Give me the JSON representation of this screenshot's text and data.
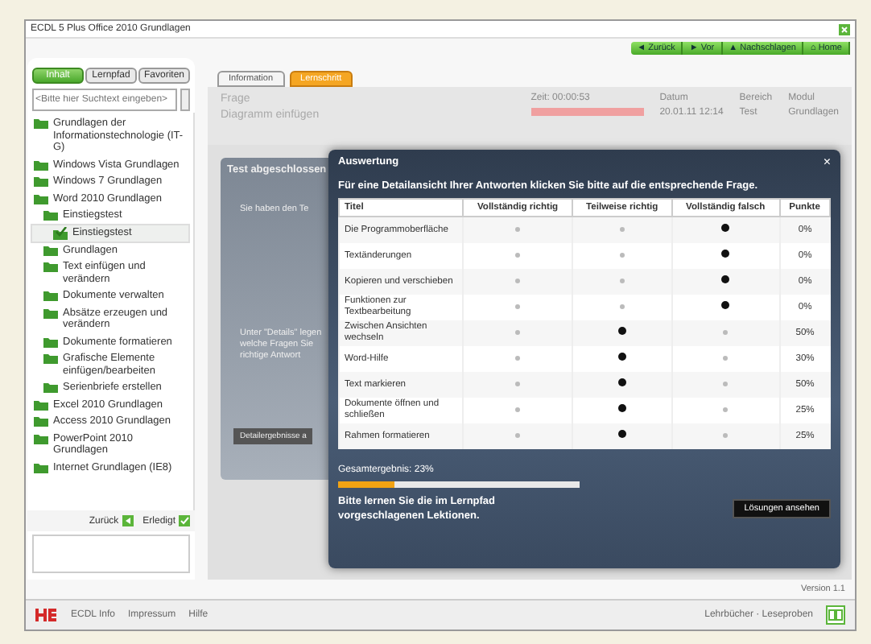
{
  "window": {
    "title": "ECDL 5 Plus Office 2010 Grundlagen"
  },
  "nav_buttons": [
    {
      "label": "◄ Zurück"
    },
    {
      "label": "► Vor"
    },
    {
      "label": "▲ Nachschlagen"
    },
    {
      "label": "⌂ Home"
    }
  ],
  "sidebar": {
    "tabs": [
      {
        "label": "Inhalt",
        "selected": true
      },
      {
        "label": "Lernpfad",
        "selected": false
      },
      {
        "label": "Favoriten",
        "selected": false
      }
    ],
    "search": {
      "placeholder": "<Bitte hier Suchtext eingeben>"
    },
    "tree": [
      {
        "label": "Grundlagen der Informationstechnologie (IT-G)",
        "selected": false
      },
      {
        "label": "Windows Vista Grundlagen",
        "selected": false
      },
      {
        "label": "Windows 7 Grundlagen",
        "selected": false
      },
      {
        "label": "Word 2010 Grundlagen",
        "selected": false,
        "children": [
          {
            "label": "Einstiegstest",
            "selected": false,
            "children": [
              {
                "label": "Einstiegstest",
                "selected": true,
                "kind": "done"
              }
            ]
          },
          {
            "label": "Grundlagen",
            "selected": false
          },
          {
            "label": "Text einfügen und verändern",
            "selected": false
          },
          {
            "label": "Dokumente verwalten",
            "selected": false
          },
          {
            "label": "Absätze erzeugen und verändern",
            "selected": false
          },
          {
            "label": "Dokumente formatieren",
            "selected": false
          },
          {
            "label": "Grafische Elemente einfügen/bearbeiten",
            "selected": false
          },
          {
            "label": "Serienbriefe erstellen",
            "selected": false
          }
        ]
      },
      {
        "label": "Excel 2010 Grundlagen",
        "selected": false
      },
      {
        "label": "Access 2010 Grundlagen",
        "selected": false
      },
      {
        "label": "PowerPoint 2010 Grundlagen",
        "selected": false
      },
      {
        "label": "Internet Grundlagen (IE8)",
        "selected": false
      }
    ],
    "bottom_buttons": [
      {
        "label": "Zurück",
        "kind": "back"
      },
      {
        "label": "Erledigt",
        "kind": "done"
      }
    ]
  },
  "main": {
    "tabs": [
      {
        "label": "Information",
        "selected": false
      },
      {
        "label": "Lernschritt",
        "selected": true
      }
    ],
    "header": [
      {
        "label": "Frage",
        "value": "Diagramm einfügen"
      },
      {
        "label": "Zeit: 00:00:53",
        "kind": "timer",
        "level": 1
      },
      {
        "label": "Datum",
        "value": "20.01.11 12:14"
      },
      {
        "label": "Bereich",
        "value": "Test"
      },
      {
        "label": "Modul",
        "value": "Grundlagen"
      }
    ],
    "test_panel": {
      "title": "Test abgeschlossen",
      "lines": [
        "Sie haben den Te",
        "Unter \"Details\" legen",
        "welche Fragen Sie",
        "richtige Antwort"
      ],
      "button": "Detailergebnisse a"
    }
  },
  "dialog": {
    "title": "Auswertung",
    "close": "×",
    "intro": "Für eine Detailansicht Ihrer Antworten klicken Sie bitte auf die entsprechende Frage.",
    "columns": [
      "Titel",
      "Vollständig richtig",
      "Teilweise richtig",
      "Vollständig falsch",
      "Punkte"
    ],
    "rows": [
      {
        "title": "Die Programmoberfläche",
        "choices": [
          {
            "selected": false
          },
          {
            "selected": false
          },
          {
            "selected": true
          }
        ],
        "points": "0%"
      },
      {
        "title": "Textänderungen",
        "choices": [
          {
            "selected": false
          },
          {
            "selected": false
          },
          {
            "selected": true
          }
        ],
        "points": "0%"
      },
      {
        "title": "Kopieren und verschieben",
        "choices": [
          {
            "selected": false
          },
          {
            "selected": false
          },
          {
            "selected": true
          }
        ],
        "points": "0%"
      },
      {
        "title": "Funktionen zur Textbearbeitung",
        "choices": [
          {
            "selected": false
          },
          {
            "selected": false
          },
          {
            "selected": true
          }
        ],
        "points": "0%"
      },
      {
        "title": "Zwischen Ansichten wechseln",
        "choices": [
          {
            "selected": false
          },
          {
            "selected": true
          },
          {
            "selected": false
          }
        ],
        "points": "50%"
      },
      {
        "title": "Word-Hilfe",
        "choices": [
          {
            "selected": false
          },
          {
            "selected": true
          },
          {
            "selected": false
          }
        ],
        "points": "30%"
      },
      {
        "title": "Text markieren",
        "choices": [
          {
            "selected": false
          },
          {
            "selected": true
          },
          {
            "selected": false
          }
        ],
        "points": "50%"
      },
      {
        "title": "Dokumente öffnen und schließen",
        "choices": [
          {
            "selected": false
          },
          {
            "selected": true
          },
          {
            "selected": false
          }
        ],
        "points": "25%"
      },
      {
        "title": "Rahmen formatieren",
        "choices": [
          {
            "selected": false
          },
          {
            "selected": true
          },
          {
            "selected": false
          }
        ],
        "points": "25%"
      }
    ],
    "total": "Gesamtergebnis: 23%",
    "level": 0.23,
    "advice": "Bitte lernen Sie die im Lernpfad vorgeschlagenen Lektionen.",
    "button": "Lösungen ansehen"
  },
  "footer": {
    "links": [
      "ECDL Info",
      "Impressum",
      "Hilfe"
    ],
    "version": "Version 1.1",
    "right_link": "Lehrbücher · Leseproben"
  }
}
